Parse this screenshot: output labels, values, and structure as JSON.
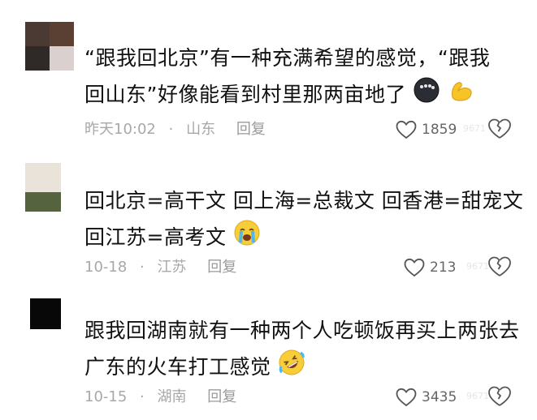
{
  "comments": [
    {
      "text_line1": "“跟我回北京”有一种充满希望的感觉，“跟我",
      "text_line2": "回山东”好像能看到村里那两亩地了",
      "time": "昨天10:02",
      "location": "山东",
      "reply_label": "回复",
      "likes": "1859",
      "avatar_colors": [
        "#4a3a33",
        "#3b302c",
        "#2f2a28",
        "#d9d0cf"
      ],
      "emoji_names": [
        "dark-face-emoji",
        "flexed-biceps-emoji"
      ]
    },
    {
      "text_line1": "回北京=高干文 回上海=总裁文 回香港=甜宠文",
      "text_line2": "回江苏=高考文",
      "time": "10-18",
      "location": "江苏",
      "reply_label": "回复",
      "likes": "213",
      "avatar_colors": [
        "#eae3da",
        "#56633f"
      ],
      "emoji_names": [
        "loudly-crying-face-emoji"
      ]
    },
    {
      "text_line1": "跟我回湖南就有一种两个人吃顿饭再买上两张去",
      "text_line2": "广东的火车打工感觉",
      "time": "10-15",
      "location": "湖南",
      "reply_label": "回复",
      "likes": "3435",
      "avatar_colors": [
        "#080808"
      ],
      "emoji_names": [
        "rolling-on-floor-laughing-emoji"
      ]
    }
  ],
  "meta_separator": "·",
  "watermark": "9671"
}
